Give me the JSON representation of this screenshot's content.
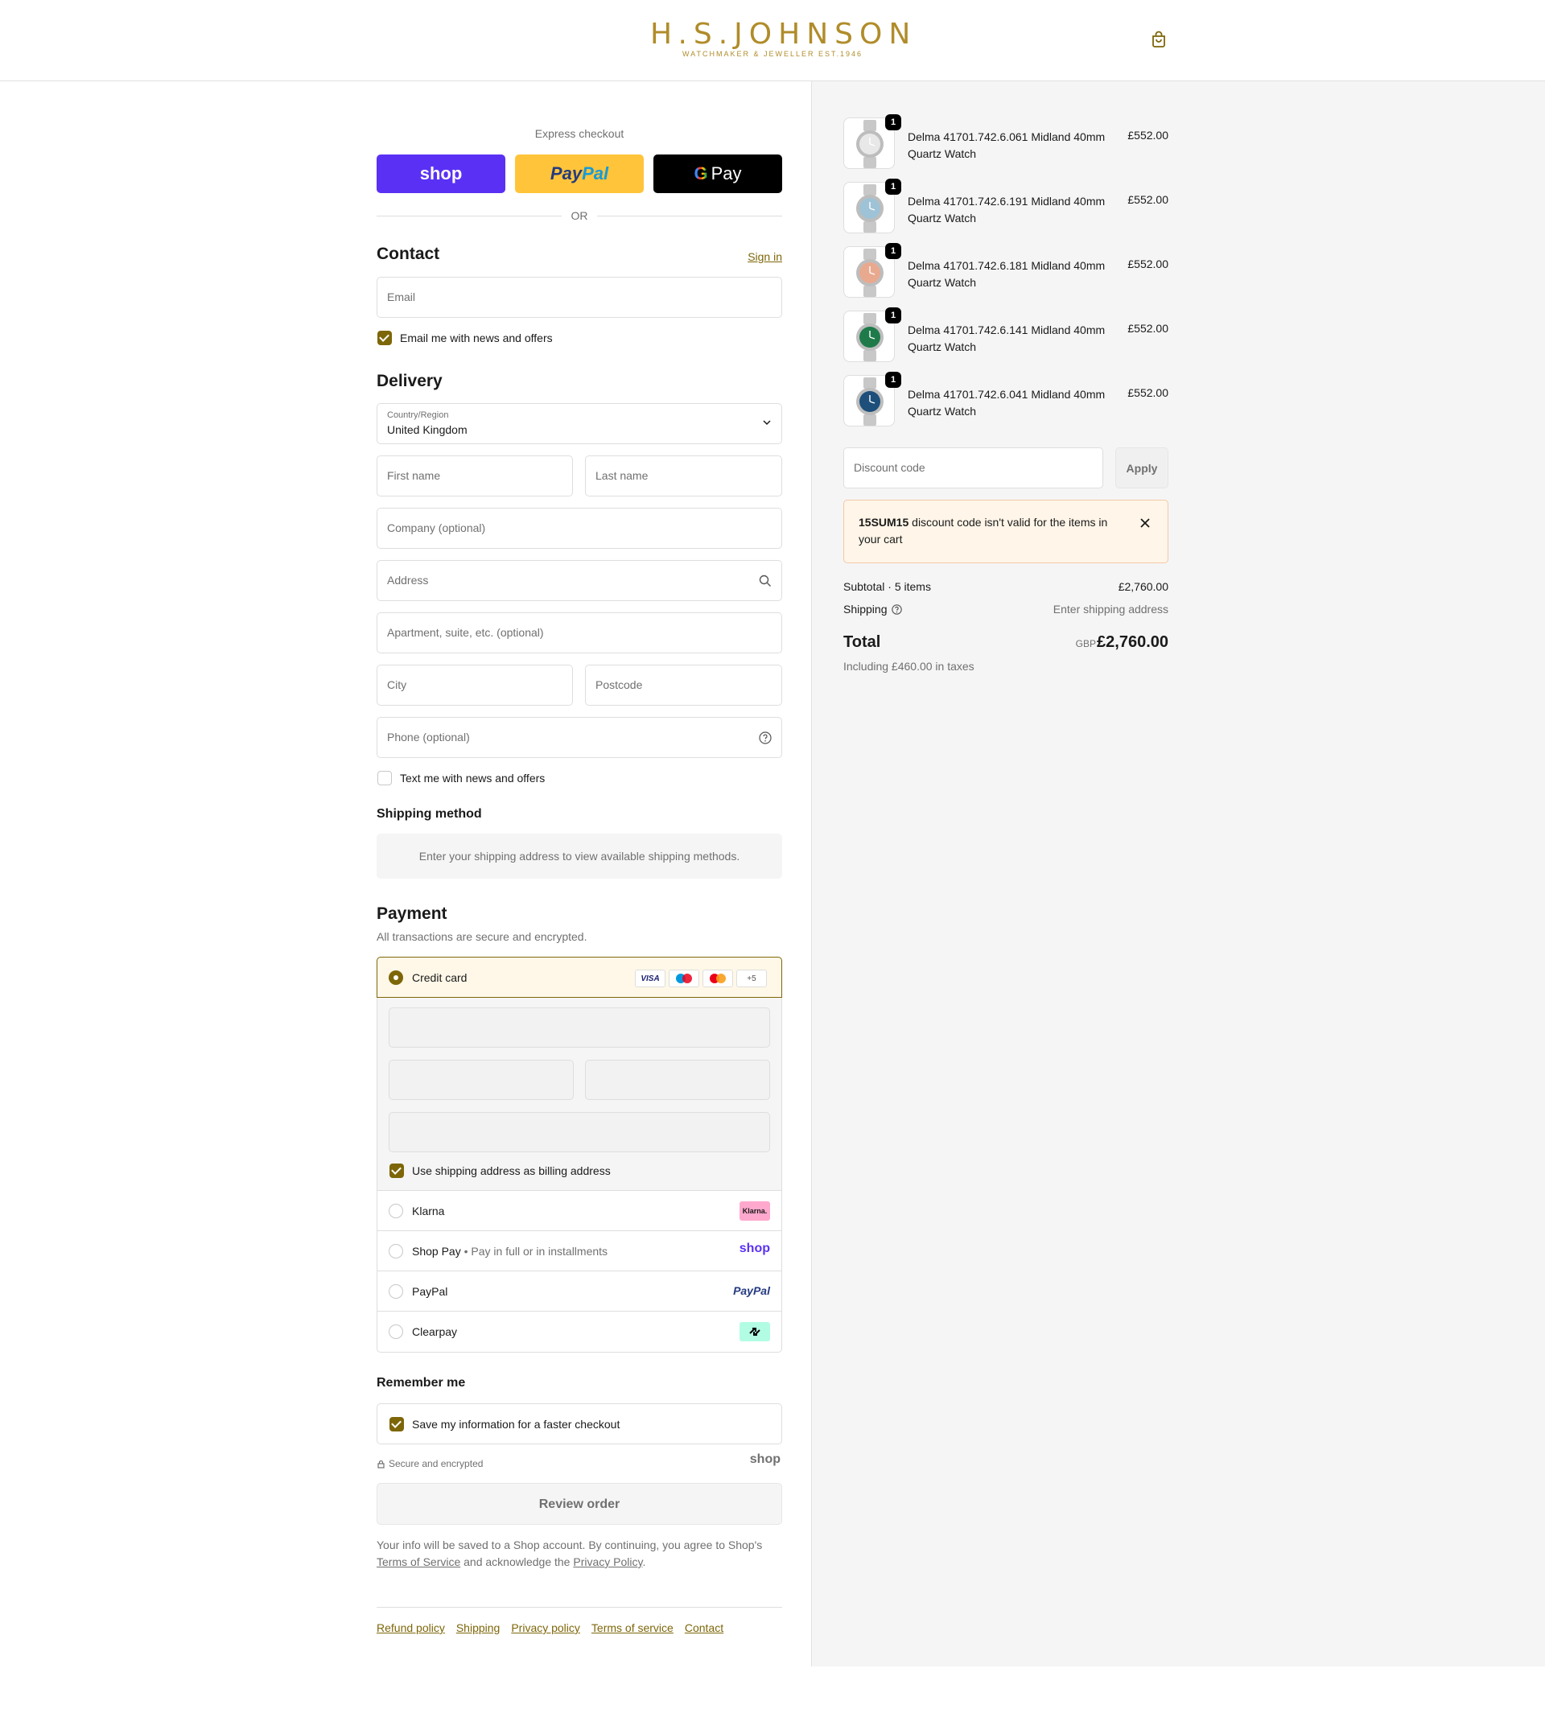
{
  "brand": {
    "name": "H.S.JOHNSON",
    "tagline": "WATCHMAKER & JEWELLER EST.1946"
  },
  "express": {
    "title": "Express checkout",
    "shop_label": "shop",
    "paypal_part1": "Pay",
    "paypal_part2": "Pal",
    "gpay_g": "G",
    "gpay_label": "Pay",
    "or_label": "OR"
  },
  "contact": {
    "title": "Contact",
    "signin": "Sign in",
    "email_placeholder": "Email",
    "news_label": "Email me with news and offers",
    "news_checked": true
  },
  "delivery": {
    "title": "Delivery",
    "country_label": "Country/Region",
    "country_value": "United Kingdom",
    "first_name": "First name",
    "last_name": "Last name",
    "company": "Company (optional)",
    "address": "Address",
    "apartment": "Apartment, suite, etc. (optional)",
    "city": "City",
    "postcode": "Postcode",
    "phone": "Phone (optional)",
    "sms_label": "Text me with news and offers",
    "sms_checked": false
  },
  "shipping_method": {
    "title": "Shipping method",
    "message": "Enter your shipping address to view available shipping methods."
  },
  "payment": {
    "title": "Payment",
    "subtitle": "All transactions are secure and encrypted.",
    "credit_card_label": "Credit card",
    "card_badges": [
      "VISA",
      "maestro",
      "mastercard",
      "+5"
    ],
    "billing_label": "Use shipping address as billing address",
    "options": [
      {
        "label": "Klarna",
        "sub": "",
        "logo": "Klarna."
      },
      {
        "label": "Shop Pay",
        "sub": "Pay in full or in installments",
        "logo": "shop"
      },
      {
        "label": "PayPal",
        "sub": "",
        "logo": "PayPal"
      },
      {
        "label": "Clearpay",
        "sub": "",
        "logo": "clearpay-icon"
      }
    ]
  },
  "remember": {
    "title": "Remember me",
    "save_label": "Save my information for a faster checkout",
    "secure_label": "Secure and encrypted",
    "shop_logo": "shop"
  },
  "review": {
    "button": "Review order",
    "legal_1": "Your info will be saved to a Shop account. By continuing, you agree to Shop's ",
    "terms": "Terms of Service",
    "legal_2": " and acknowledge the ",
    "privacy": "Privacy Policy",
    "legal_3": "."
  },
  "footer_links": [
    "Refund policy",
    "Shipping",
    "Privacy policy",
    "Terms of service",
    "Contact"
  ],
  "cart": {
    "items": [
      {
        "qty": "1",
        "name": "Delma 41701.742.6.061 Midland 40mm Quartz Watch",
        "price": "£552.00",
        "dial": "#e8e8e8"
      },
      {
        "qty": "1",
        "name": "Delma 41701.742.6.191 Midland 40mm Quartz Watch",
        "price": "£552.00",
        "dial": "#9fc3d6"
      },
      {
        "qty": "1",
        "name": "Delma 41701.742.6.181 Midland 40mm Quartz Watch",
        "price": "£552.00",
        "dial": "#e9a98f"
      },
      {
        "qty": "1",
        "name": "Delma 41701.742.6.141 Midland 40mm Quartz Watch",
        "price": "£552.00",
        "dial": "#1f7a4a"
      },
      {
        "qty": "1",
        "name": "Delma 41701.742.6.041 Midland 40mm Quartz Watch",
        "price": "£552.00",
        "dial": "#1d4f7a"
      }
    ],
    "discount_placeholder": "Discount code",
    "apply_label": "Apply",
    "notice_code": "15SUM15",
    "notice_text": " discount code isn't valid for the items in your cart",
    "subtotal_label": "Subtotal · 5 items",
    "subtotal_value": "£2,760.00",
    "shipping_label": "Shipping",
    "shipping_value": "Enter shipping address",
    "total_label": "Total",
    "currency": "GBP",
    "total_value": "£2,760.00",
    "taxes": "Including £460.00 in taxes"
  },
  "colors": {
    "accent": "#7d6608",
    "brand_gold": "#b08c2a",
    "shop_purple": "#5a31f4",
    "paypal_yellow": "#ffc439"
  }
}
